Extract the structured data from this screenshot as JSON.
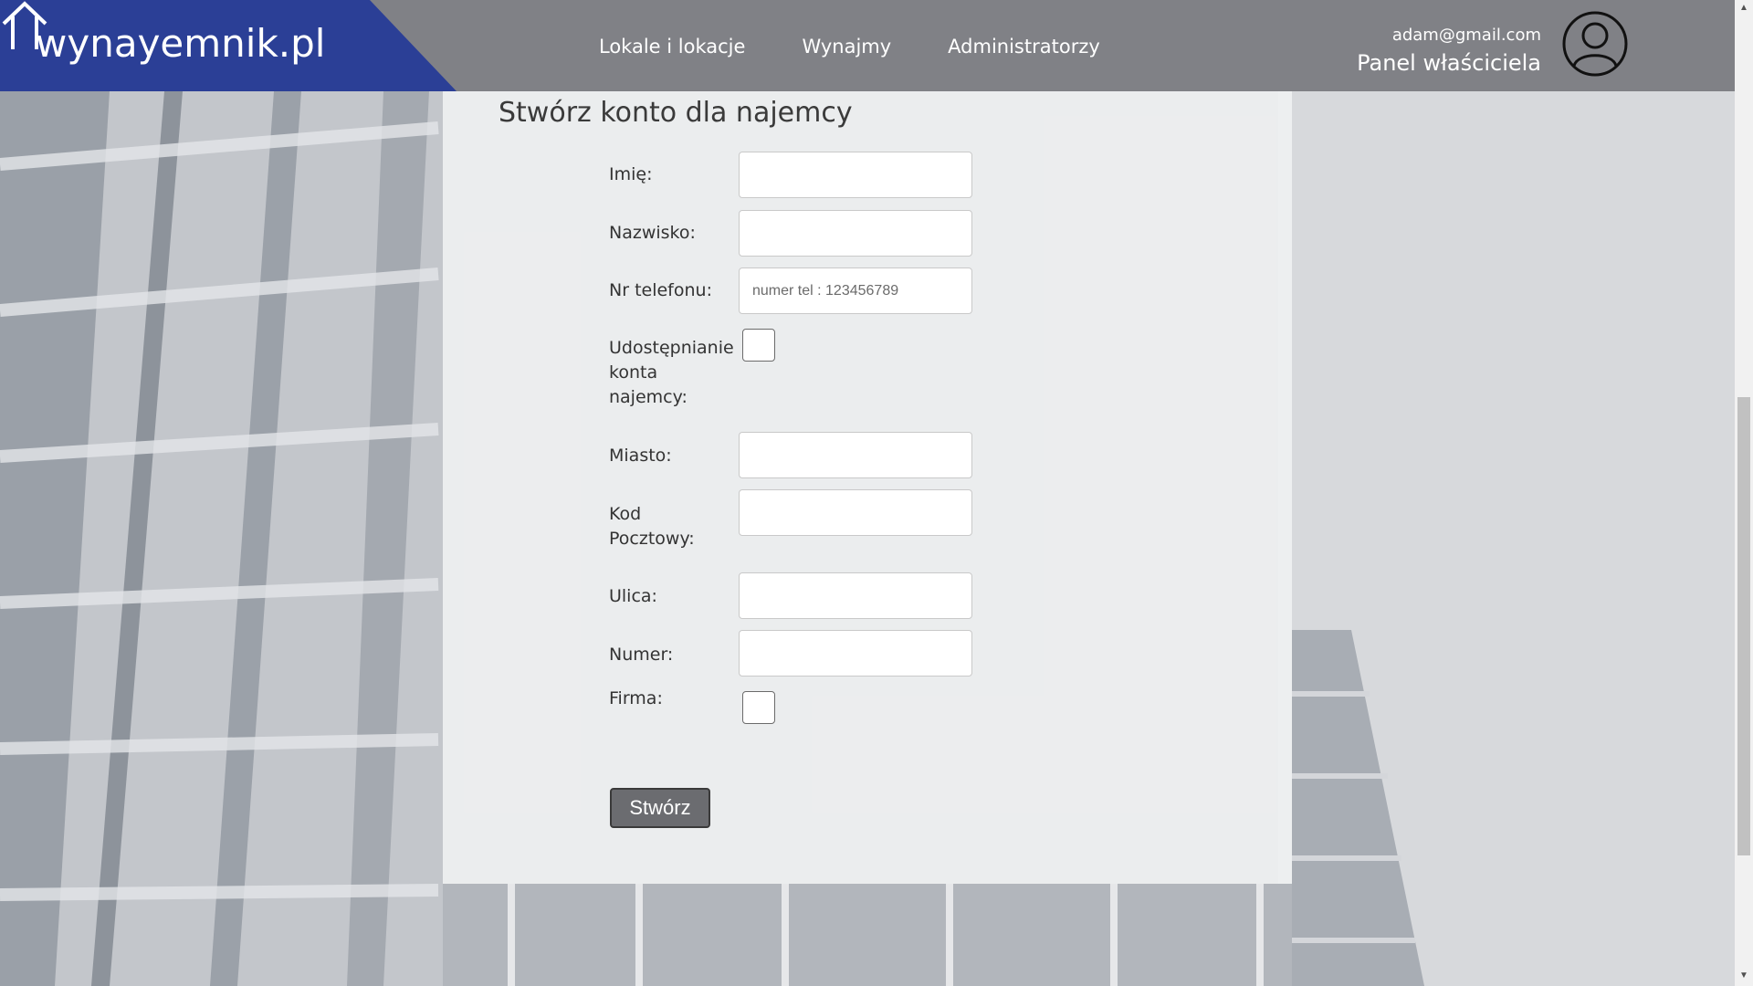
{
  "header": {
    "logo_text": "wynayemnik.pl",
    "nav": [
      {
        "label": "Lokale i lokacje"
      },
      {
        "label": "Wynajmy"
      },
      {
        "label": "Administratorzy"
      }
    ],
    "user_email": "adam@gmail.com",
    "user_role": "Panel właściciela",
    "avatar_icon": "user-circle-icon"
  },
  "form": {
    "title": "Stwórz konto dla najemcy",
    "fields": {
      "first_name": {
        "label": "Imię:",
        "value": ""
      },
      "last_name": {
        "label": "Nazwisko:",
        "value": ""
      },
      "phone": {
        "label": "Nr telefonu:",
        "placeholder": "numer tel : 123456789",
        "value": ""
      },
      "share_account": {
        "label": "Udostępnianie konta najemcy:",
        "checked": false
      },
      "city": {
        "label": "Miasto:",
        "value": ""
      },
      "postal_code": {
        "label": "Kod Pocztowy:",
        "value": ""
      },
      "street": {
        "label": "Ulica:",
        "value": ""
      },
      "number": {
        "label": "Numer:",
        "value": ""
      },
      "company": {
        "label": "Firma:",
        "checked": false
      }
    },
    "submit_label": "Stwórz"
  },
  "colors": {
    "header_bg": "#808186",
    "logo_bg": "#2b3f96",
    "button_bg": "#6b6c70"
  }
}
